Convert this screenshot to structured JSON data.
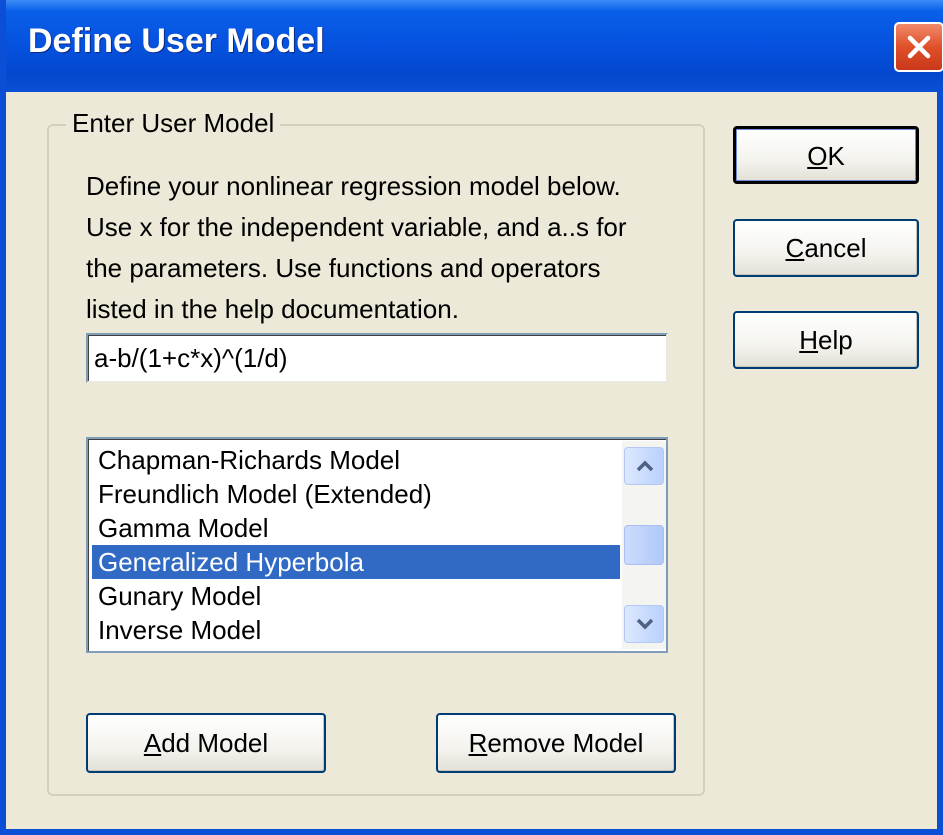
{
  "window": {
    "title": "Define User Model",
    "close_icon": "close-icon"
  },
  "group": {
    "legend": "Enter User Model",
    "description_lines": [
      "Define your nonlinear regression model below.",
      "Use x for the independent variable, and a..s for",
      "the parameters.  Use functions and operators",
      "listed in the help documentation."
    ]
  },
  "formula": {
    "value": "a-b/(1+c*x)^(1/d)"
  },
  "model_list": {
    "items": [
      "Chapman-Richards Model",
      "Freundlich Model (Extended)",
      "Gamma Model",
      "Generalized Hyperbola",
      "Gunary Model",
      "Inverse Model"
    ],
    "selected_index": 3,
    "scroll_up_icon": "chevron-up-icon",
    "scroll_down_icon": "chevron-down-icon"
  },
  "buttons": {
    "ok": {
      "mnemonic": "O",
      "rest": "K"
    },
    "cancel": {
      "mnemonic": "C",
      "rest": "ancel"
    },
    "help": {
      "mnemonic": "H",
      "rest": "elp"
    },
    "add_model": {
      "mnemonic": "A",
      "rest": "dd Model"
    },
    "remove_model": {
      "mnemonic": "R",
      "rest": "emove Model"
    }
  },
  "colors": {
    "titlebar": "#0553e0",
    "selection": "#316ac5",
    "dialog_bg": "#ece9d8"
  }
}
